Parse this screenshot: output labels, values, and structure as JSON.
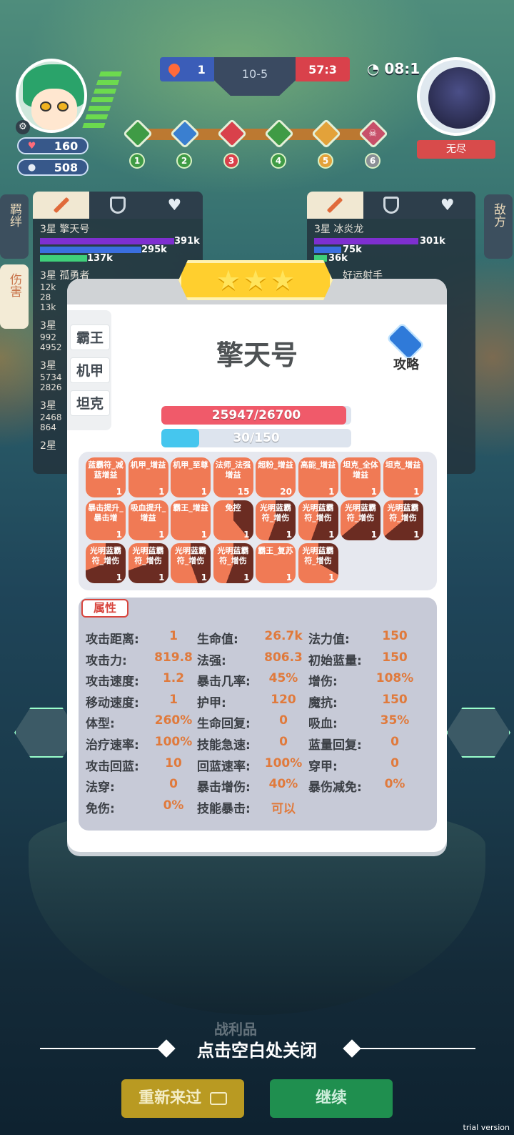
{
  "hud": {
    "player_hp": "160",
    "player_coins": "508",
    "blue_score": "1",
    "round": "10-5",
    "red_score": "57:3",
    "timer": "08:1",
    "enemy_label": "无尽",
    "stages": [
      "1",
      "2",
      "3",
      "4",
      "5",
      "6"
    ]
  },
  "left_tabs": [
    "羁绊",
    "伤害"
  ],
  "right_tab": "敌方",
  "left_list": [
    {
      "name": "3星 擎天号",
      "bars": [
        "391k",
        "295k",
        "137k"
      ]
    },
    {
      "name": "3星 孤勇者",
      "bars": [
        "12k",
        "28",
        "13k"
      ]
    },
    {
      "name": "3星",
      "bars": [
        "992",
        "4952"
      ]
    },
    {
      "name": "3星",
      "bars": [
        "5734",
        "2826"
      ]
    },
    {
      "name": "3星",
      "bars": [
        "2468",
        "864"
      ]
    },
    {
      "name": "2星",
      "bars": []
    }
  ],
  "right_list": [
    {
      "name": "3星 冰炎龙",
      "bars": [
        "301k",
        "75k",
        "36k"
      ]
    },
    {
      "name": "好运射手",
      "bars": []
    }
  ],
  "modal": {
    "traits": [
      "霸王",
      "机甲",
      "坦克"
    ],
    "hero_name": "擎天号",
    "guide_label": "攻略",
    "hp_text": "25947/26700",
    "hp_ratio": 0.972,
    "mana_text": "30/150",
    "mana_ratio": 0.2,
    "equipment": [
      {
        "name": "蓝霸符_减蓝增益",
        "count": "1"
      },
      {
        "name": "机甲_增益",
        "count": "1"
      },
      {
        "name": "机甲_至尊",
        "count": "1"
      },
      {
        "name": "法师_法强增益",
        "count": "15"
      },
      {
        "name": "超粉_增益",
        "count": "20"
      },
      {
        "name": "高能_增益",
        "count": "1"
      },
      {
        "name": "坦克_全体增益",
        "count": "1"
      },
      {
        "name": "坦克_增益",
        "count": "1"
      },
      {
        "name": "暴击提升_暴击增",
        "count": "1"
      },
      {
        "name": "吸血提升_增益",
        "count": "1"
      },
      {
        "name": "霸王_增益",
        "count": "1"
      },
      {
        "name": "免控",
        "count": "1"
      },
      {
        "name": "光明蓝霸符_增伤",
        "count": "1"
      },
      {
        "name": "光明蓝霸符_增伤",
        "count": "1"
      },
      {
        "name": "光明蓝霸符_增伤",
        "count": "1"
      },
      {
        "name": "光明蓝霸符_增伤",
        "count": "1"
      },
      {
        "name": "光明蓝霸符_增伤",
        "count": "1"
      },
      {
        "name": "光明蓝霸符_增伤",
        "count": "1"
      },
      {
        "name": "光明蓝霸符_增伤",
        "count": "1"
      },
      {
        "name": "光明蓝霸符_增伤",
        "count": "1"
      },
      {
        "name": "霸王_复苏",
        "count": "1"
      },
      {
        "name": "光明蓝霸符_增伤",
        "count": "1"
      }
    ],
    "attr_title": "属性",
    "attributes": [
      [
        {
          "k": "攻击距离:",
          "v": "1"
        },
        {
          "k": "生命值:",
          "v": "26.7k"
        },
        {
          "k": "法力值:",
          "v": "150"
        }
      ],
      [
        {
          "k": "攻击力:",
          "v": "819.8"
        },
        {
          "k": "法强:",
          "v": "806.3"
        },
        {
          "k": "初始蓝量:",
          "v": "150"
        }
      ],
      [
        {
          "k": "攻击速度:",
          "v": "1.2"
        },
        {
          "k": "暴击几率:",
          "v": "45%"
        },
        {
          "k": "增伤:",
          "v": "108%"
        }
      ],
      [
        {
          "k": "移动速度:",
          "v": "1"
        },
        {
          "k": "护甲:",
          "v": "120"
        },
        {
          "k": "魔抗:",
          "v": "150"
        }
      ],
      [
        {
          "k": "体型:",
          "v": "260%"
        },
        {
          "k": "生命回复:",
          "v": "0"
        },
        {
          "k": "吸血:",
          "v": "35%"
        }
      ],
      [
        {
          "k": "治疗速率:",
          "v": "100%"
        },
        {
          "k": "技能急速:",
          "v": "0"
        },
        {
          "k": "蓝量回复:",
          "v": "0"
        }
      ],
      [
        {
          "k": "攻击回蓝:",
          "v": "10"
        },
        {
          "k": "回蓝速率:",
          "v": "100%"
        },
        {
          "k": "穿甲:",
          "v": "0"
        }
      ],
      [
        {
          "k": "法穿:",
          "v": "0"
        },
        {
          "k": "暴击增伤:",
          "v": "40%"
        },
        {
          "k": "暴伤减免:",
          "v": "0%"
        }
      ],
      [
        {
          "k": "免伤:",
          "v": "0%"
        },
        {
          "k": "技能暴击:",
          "v": "可以"
        }
      ]
    ]
  },
  "bottom": {
    "hint": "点击空白处关闭",
    "behind_text": "战利品",
    "retry": "重新来过",
    "continue": "继续",
    "watermark": "trial version"
  },
  "colors": {
    "accent": "#f07a55",
    "hp": "#f05a6a",
    "mana": "#45c6ee",
    "retry": "#b99a22",
    "continue": "#1f8f4f"
  }
}
